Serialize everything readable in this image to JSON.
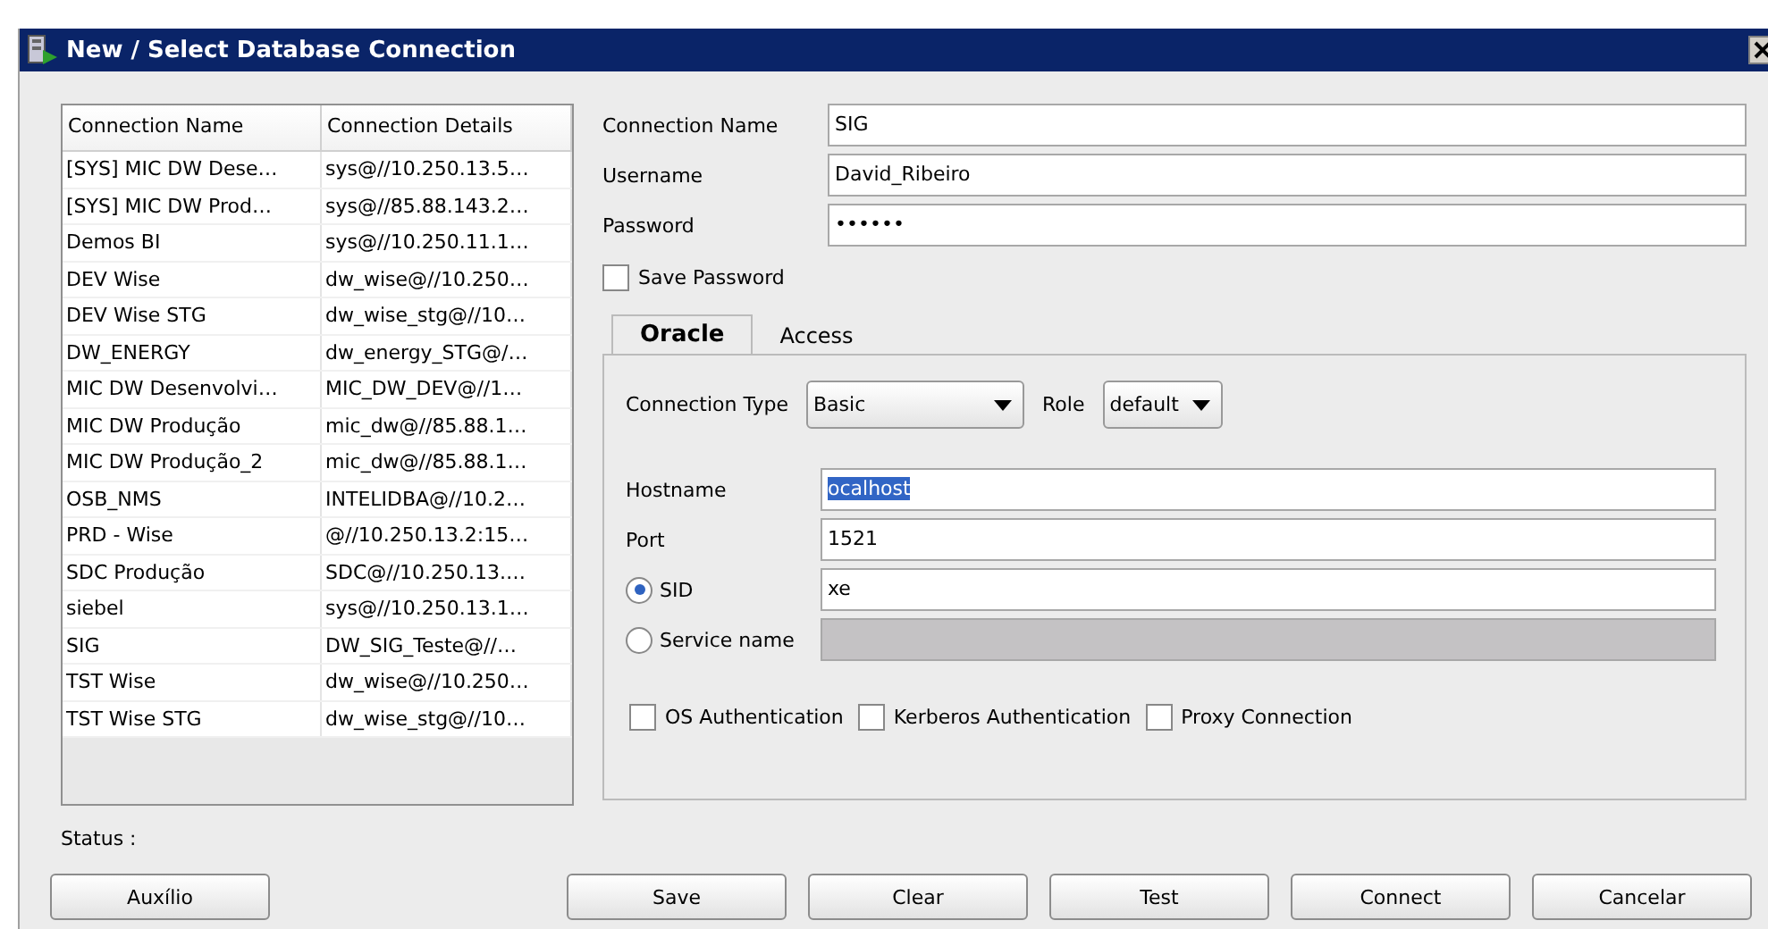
{
  "window": {
    "title": "New / Select Database Connection"
  },
  "connections": {
    "columns": [
      "Connection Name",
      "Connection Details"
    ],
    "rows": [
      {
        "name": "[SYS] MIC DW Dese…",
        "details": "sys@//10.250.13.5…"
      },
      {
        "name": "[SYS] MIC DW Prod…",
        "details": "sys@//85.88.143.2…"
      },
      {
        "name": "Demos BI",
        "details": "sys@//10.250.11.1…"
      },
      {
        "name": "DEV Wise",
        "details": "dw_wise@//10.250…"
      },
      {
        "name": "DEV Wise STG",
        "details": "dw_wise_stg@//10…"
      },
      {
        "name": "DW_ENERGY",
        "details": "dw_energy_STG@/…"
      },
      {
        "name": "MIC DW Desenvolvi…",
        "details": "MIC_DW_DEV@//1…"
      },
      {
        "name": "MIC DW Produção",
        "details": "mic_dw@//85.88.1…"
      },
      {
        "name": "MIC DW Produção_2",
        "details": "mic_dw@//85.88.1…"
      },
      {
        "name": "OSB_NMS",
        "details": "INTELIDBA@//10.2…"
      },
      {
        "name": "PRD - Wise",
        "details": "@//10.250.13.2:15…"
      },
      {
        "name": "SDC Produção",
        "details": "SDC@//10.250.13.…"
      },
      {
        "name": "siebel",
        "details": "sys@//10.250.13.1…"
      },
      {
        "name": "SIG",
        "details": "DW_SIG_Teste@//…"
      },
      {
        "name": "TST Wise",
        "details": "dw_wise@//10.250…"
      },
      {
        "name": "TST Wise STG",
        "details": "dw_wise_stg@//10…"
      }
    ]
  },
  "form": {
    "fields": [
      {
        "label": "Connection Name",
        "value": "SIG"
      },
      {
        "label": "Username",
        "value": "David_Ribeiro"
      },
      {
        "label": "Password",
        "value": "••••••"
      }
    ],
    "save_password": {
      "label": "Save Password",
      "checked": false
    }
  },
  "tabs": [
    {
      "label": "Oracle",
      "selected": true
    },
    {
      "label": "Access",
      "selected": false
    }
  ],
  "oracle": {
    "connection_type": {
      "label": "Connection Type",
      "value": "Basic"
    },
    "role": {
      "label": "Role",
      "value": "default"
    },
    "fields": [
      {
        "kind": "text",
        "label": "Hostname",
        "value": "ocalhost",
        "text_selected": true,
        "disabled": false
      },
      {
        "kind": "text",
        "label": "Port",
        "value": "1521",
        "text_selected": false,
        "disabled": false
      },
      {
        "kind": "radio",
        "label": "SID",
        "value": "xe",
        "selected": true,
        "text_selected": false,
        "disabled": false
      },
      {
        "kind": "radio",
        "label": "Service name",
        "selected": false,
        "disabled": true
      }
    ],
    "options": [
      {
        "label": "OS Authentication",
        "checked": false
      },
      {
        "label": "Kerberos Authentication",
        "checked": false
      },
      {
        "label": "Proxy Connection",
        "checked": false
      }
    ]
  },
  "status": {
    "label": "Status :"
  },
  "buttons": [
    {
      "label": "Auxílio"
    },
    {
      "label": "Save"
    },
    {
      "label": "Clear"
    },
    {
      "label": "Test"
    },
    {
      "label": "Connect"
    },
    {
      "label": "Cancelar"
    }
  ]
}
